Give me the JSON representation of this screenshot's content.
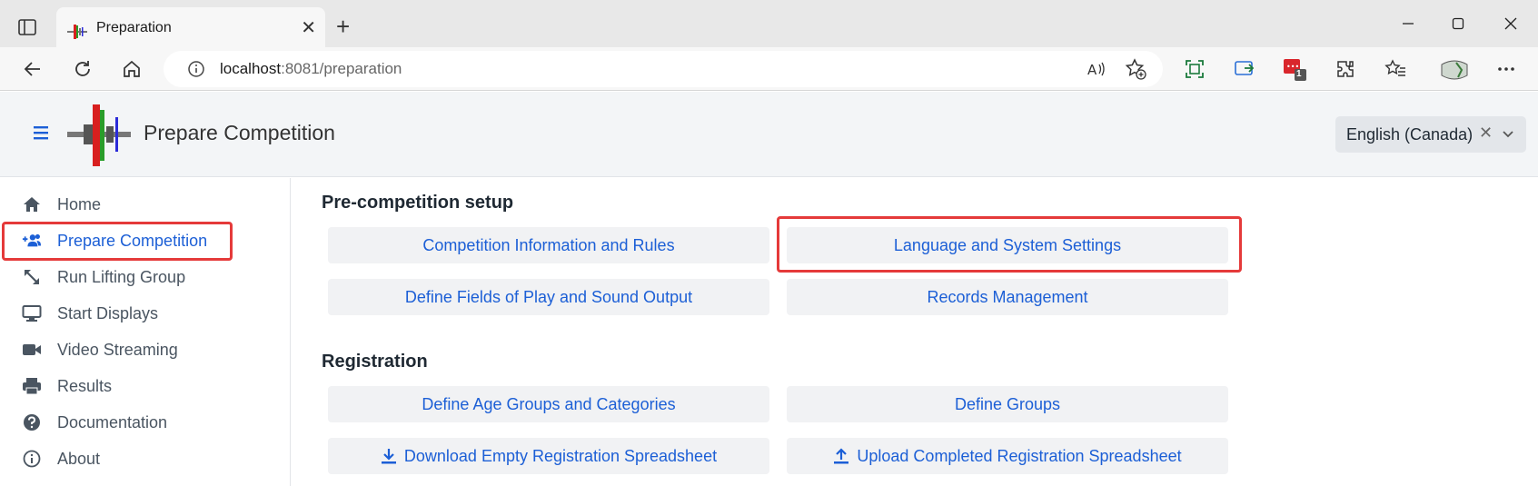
{
  "browser": {
    "tab_title": "Preparation",
    "url_host": "localhost",
    "url_path": ":8081/preparation",
    "notification_count": "1"
  },
  "app": {
    "title": "Prepare Competition",
    "language": "English (Canada)",
    "language_clear": "✕"
  },
  "sidebar": {
    "items": [
      {
        "label": "Home",
        "icon": "home-icon"
      },
      {
        "label": "Prepare Competition",
        "icon": "users-plus-icon",
        "active": true
      },
      {
        "label": "Run Lifting Group",
        "icon": "resize-arrows-icon"
      },
      {
        "label": "Start Displays",
        "icon": "desktop-icon"
      },
      {
        "label": "Video Streaming",
        "icon": "video-camera-icon"
      },
      {
        "label": "Results",
        "icon": "printer-icon"
      },
      {
        "label": "Documentation",
        "icon": "question-icon"
      },
      {
        "label": "About",
        "icon": "info-icon"
      }
    ]
  },
  "main": {
    "section_setup": "Pre-competition setup",
    "section_registration": "Registration",
    "buttons": {
      "competition_info": "Competition Information and Rules",
      "language_settings": "Language and System Settings",
      "fields_of_play": "Define Fields of Play and Sound Output",
      "records": "Records Management",
      "age_groups": "Define Age Groups and Categories",
      "groups": "Define Groups",
      "download_spreadsheet": "Download Empty Registration Spreadsheet",
      "upload_spreadsheet": "Upload Completed Registration Spreadsheet"
    }
  },
  "colors": {
    "accent": "#1c5fd6",
    "highlight": "#e53a3a"
  }
}
